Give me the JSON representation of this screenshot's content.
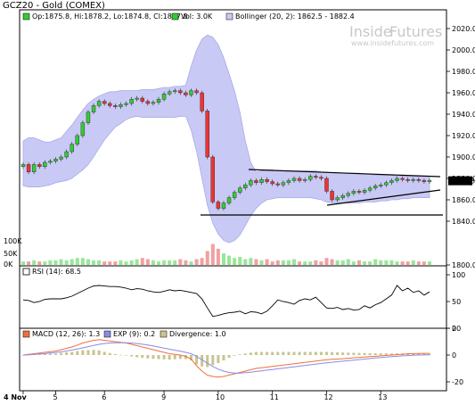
{
  "title": "GCZ20 - Gold (COMEX)",
  "watermark": {
    "brand_a": "Inside",
    "brand_b": "Futures",
    "url": "www.insidefutures.com"
  },
  "legend_price": {
    "ohlc": "Op:1875.8, Hi:1878.2, Lo:1874.8, Cl:1877.8",
    "volume": "Vol: 3.0K",
    "bollinger": "Bollinger (20, 2): 1862.5 - 1882.4"
  },
  "legend_rsi": {
    "rsi": "RSI (14): 68.5"
  },
  "legend_macd": {
    "macd": "MACD (12, 26): 1.3",
    "exp": "EXP (9): 0.2",
    "divergence": "Divergence: 1.0"
  },
  "colors": {
    "up": "#33cc33",
    "down": "#ee3333",
    "band": "#c9c9f5",
    "band_edge": "#9a9ae6",
    "macd": "#f0703a",
    "exp": "#8a8ae8",
    "div": "#c8c490",
    "last_box": "#000000"
  },
  "chart_data": [
    {
      "type": "candlestick",
      "title": "GCZ20 - Gold (COMEX)",
      "x_tick_labels": [
        "4 Nov",
        "5",
        "6",
        "9",
        "10",
        "11",
        "12",
        "13"
      ],
      "y_ticks": [
        1800,
        1840,
        1860,
        1880,
        1900,
        1920,
        1940,
        1960,
        1980,
        2000,
        2020
      ],
      "ylim": [
        1800,
        2025
      ],
      "last_value": "1877.8",
      "series": [
        {
          "name": "Close",
          "values": [
            1893,
            1886,
            1893,
            1891,
            1895,
            1896,
            1898,
            1900,
            1905,
            1912,
            1920,
            1932,
            1942,
            1948,
            1952,
            1950,
            1948,
            1947,
            1949,
            1950,
            1954,
            1955,
            1952,
            1950,
            1951,
            1954,
            1959,
            1961,
            1962,
            1960,
            1958,
            1962,
            1960,
            1943,
            1900,
            1858,
            1852,
            1857,
            1862,
            1867,
            1871,
            1874,
            1878,
            1876,
            1879,
            1877,
            1875,
            1874,
            1876,
            1878,
            1880,
            1878,
            1879,
            1882,
            1881,
            1880,
            1868,
            1860,
            1862,
            1864,
            1866,
            1868,
            1867,
            1869,
            1871,
            1873,
            1874,
            1876,
            1878,
            1880,
            1879,
            1878,
            1879,
            1878,
            1877,
            1878
          ]
        },
        {
          "name": "Bollinger upper",
          "values": [
            1915,
            1918,
            1918,
            1916,
            1914,
            1914,
            1916,
            1918,
            1924,
            1930,
            1937,
            1944,
            1950,
            1954,
            1957,
            1959,
            1961,
            1961,
            1962,
            1962,
            1962,
            1962,
            1963,
            1963,
            1963,
            1964,
            1965,
            1965,
            1966,
            1966,
            1967,
            1985,
            2000,
            2010,
            2014,
            2012,
            2005,
            1993,
            1978,
            1962,
            1942,
            1915,
            1895,
            1886,
            1887,
            1888,
            1888,
            1887,
            1887,
            1887,
            1887,
            1887,
            1887,
            1887,
            1887,
            1886,
            1886,
            1885,
            1885,
            1885,
            1885,
            1885,
            1885,
            1884,
            1884,
            1883,
            1883,
            1883,
            1883,
            1882,
            1882,
            1882,
            1882,
            1882,
            1882,
            1882
          ]
        },
        {
          "name": "Bollinger lower",
          "values": [
            1873,
            1872,
            1872,
            1872,
            1873,
            1874,
            1876,
            1877,
            1878,
            1880,
            1884,
            1888,
            1893,
            1900,
            1908,
            1916,
            1922,
            1928,
            1931,
            1935,
            1937,
            1938,
            1937,
            1937,
            1937,
            1937,
            1937,
            1937,
            1937,
            1938,
            1938,
            1925,
            1905,
            1880,
            1855,
            1838,
            1828,
            1822,
            1820,
            1822,
            1827,
            1836,
            1845,
            1852,
            1857,
            1860,
            1861,
            1862,
            1862,
            1862,
            1862,
            1862,
            1862,
            1862,
            1861,
            1860,
            1858,
            1857,
            1857,
            1857,
            1857,
            1857,
            1857,
            1858,
            1858,
            1858,
            1859,
            1859,
            1860,
            1860,
            1861,
            1861,
            1862,
            1862,
            1862,
            1862
          ]
        },
        {
          "name": "Volume",
          "values": [
            3,
            3,
            4,
            3,
            3,
            4,
            4,
            5,
            4,
            5,
            6,
            6,
            5,
            4,
            4,
            3,
            3,
            3,
            4,
            3,
            4,
            5,
            6,
            5,
            4,
            3,
            4,
            4,
            4,
            5,
            4,
            3,
            5,
            6,
            12,
            18,
            14,
            10,
            8,
            6,
            7,
            5,
            6,
            5,
            4,
            5,
            3,
            4,
            4,
            4,
            5,
            3,
            3,
            3,
            4,
            3,
            6,
            5,
            4,
            4,
            5,
            3,
            4,
            3,
            3,
            5,
            4,
            4,
            4,
            3,
            3,
            3,
            4,
            3,
            3,
            3
          ]
        }
      ]
    },
    {
      "type": "line",
      "y_ticks": [
        0,
        50,
        100
      ],
      "ylim": [
        0,
        100
      ],
      "series": [
        {
          "name": "RSI",
          "values": [
            53,
            52,
            48,
            50,
            54,
            55,
            55,
            55,
            57,
            60,
            65,
            70,
            75,
            79,
            80,
            79,
            78,
            78,
            77,
            75,
            72,
            74,
            73,
            70,
            68,
            67,
            69,
            72,
            70,
            71,
            69,
            67,
            65,
            55,
            38,
            22,
            24,
            27,
            29,
            30,
            32,
            27,
            31,
            30,
            27,
            32,
            42,
            53,
            50,
            48,
            45,
            52,
            55,
            53,
            58,
            48,
            38,
            37,
            39,
            35,
            37,
            34,
            35,
            42,
            38,
            44,
            48,
            55,
            62,
            80,
            70,
            75,
            67,
            70,
            62,
            68
          ]
        }
      ]
    },
    {
      "type": "line",
      "y_ticks": [
        -40,
        -20,
        0,
        20
      ],
      "ylim": [
        -40,
        20
      ],
      "series": [
        {
          "name": "MACD",
          "values": [
            0,
            0.5,
            1,
            1.5,
            2,
            2.5,
            3,
            4,
            5,
            6,
            7.5,
            9,
            10,
            11,
            11.5,
            11,
            10.5,
            10,
            9.5,
            9,
            8,
            7,
            6,
            5,
            4,
            3,
            2,
            1,
            0.5,
            0,
            -1,
            -3,
            -8,
            -12,
            -15,
            -16,
            -16.5,
            -16,
            -15,
            -14,
            -13,
            -12,
            -11,
            -10,
            -9.5,
            -9,
            -8.5,
            -8,
            -7.5,
            -7,
            -6.5,
            -6,
            -5.5,
            -5,
            -4.5,
            -4,
            -3.5,
            -3.2,
            -3,
            -2.7,
            -2.4,
            -2.1,
            -1.8,
            -1.5,
            -1.2,
            -0.9,
            -0.6,
            -0.3,
            0,
            0.3,
            0.6,
            0.9,
            1.1,
            1.2,
            1.3,
            1.3
          ]
        },
        {
          "name": "EXP",
          "values": [
            0,
            0.2,
            0.5,
            0.8,
            1.1,
            1.5,
            1.9,
            2.4,
            3,
            3.7,
            4.5,
            5.4,
            6.3,
            7.2,
            8,
            8.6,
            9,
            9.2,
            9.3,
            9.2,
            9,
            8.6,
            8.1,
            7.5,
            6.8,
            6,
            5.2,
            4.4,
            3.6,
            2.9,
            2,
            1,
            -1,
            -3.5,
            -6,
            -8.5,
            -10.5,
            -12,
            -13,
            -13.5,
            -13.5,
            -13.2,
            -12.8,
            -12.3,
            -11.8,
            -11.3,
            -10.8,
            -10.3,
            -9.8,
            -9.3,
            -8.8,
            -8.3,
            -7.8,
            -7.3,
            -6.8,
            -6.3,
            -5.8,
            -5.4,
            -5,
            -4.6,
            -4.2,
            -3.8,
            -3.4,
            -3,
            -2.6,
            -2.2,
            -1.8,
            -1.5,
            -1.2,
            -0.9,
            -0.6,
            -0.4,
            -0.2,
            0,
            0.1,
            0.2
          ]
        },
        {
          "name": "Divergence",
          "values": [
            0,
            0.3,
            0.5,
            0.7,
            0.9,
            1,
            1.1,
            1.6,
            2,
            2.3,
            3,
            3.6,
            3.7,
            3.8,
            3.5,
            2.4,
            1.5,
            0.8,
            0.2,
            -0.2,
            -1,
            -1.6,
            -2.1,
            -2.5,
            -2.8,
            -3,
            -3.2,
            -3.4,
            -3.1,
            -2.9,
            -3,
            -4,
            -7,
            -8.5,
            -9,
            -7.5,
            -6,
            -4,
            -2,
            -0.5,
            0.5,
            1.2,
            1.8,
            2.3,
            2.3,
            2.3,
            2.3,
            2.3,
            2.3,
            2.3,
            2.3,
            2.3,
            2.3,
            2.3,
            2.3,
            2.3,
            2.3,
            2.2,
            2,
            1.9,
            1.8,
            1.7,
            1.6,
            1.5,
            1.4,
            1.3,
            1.2,
            1.2,
            1.2,
            1.2,
            1.2,
            1.3,
            1.3,
            1.2,
            1.2,
            1.1
          ]
        }
      ]
    }
  ]
}
